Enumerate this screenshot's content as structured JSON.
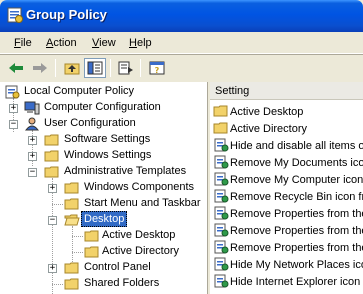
{
  "window": {
    "title": "Group Policy"
  },
  "menubar": [
    {
      "label": "File",
      "accel": "F",
      "rest": "ile"
    },
    {
      "label": "Action",
      "accel": "A",
      "rest": "ction"
    },
    {
      "label": "View",
      "accel": "V",
      "rest": "iew"
    },
    {
      "label": "Help",
      "accel": "H",
      "rest": "elp"
    }
  ],
  "toolbar": [
    "back-icon",
    "forward-icon",
    "up-folder-icon",
    "show-hide-tree-icon",
    "export-list-icon",
    "help-icon"
  ],
  "tree": [
    {
      "label": "Local Computer Policy",
      "icon": "policy-icon"
    },
    {
      "label": "Computer Configuration",
      "icon": "computer-icon",
      "expander": "+"
    },
    {
      "label": "User Configuration",
      "icon": "user-icon",
      "expander": "−"
    },
    {
      "label": "Software Settings",
      "icon": "folder-icon",
      "expander": "+"
    },
    {
      "label": "Windows Settings",
      "icon": "folder-icon",
      "expander": "+"
    },
    {
      "label": "Administrative Templates",
      "icon": "folder-icon",
      "expander": "−"
    },
    {
      "label": "Windows Components",
      "icon": "folder-icon",
      "expander": "+"
    },
    {
      "label": "Start Menu and Taskbar",
      "icon": "folder-icon"
    },
    {
      "label": "Desktop",
      "icon": "folder-open-icon",
      "expander": "−",
      "selected": true
    },
    {
      "label": "Active Desktop",
      "icon": "folder-icon"
    },
    {
      "label": "Active Directory",
      "icon": "folder-icon"
    },
    {
      "label": "Control Panel",
      "icon": "folder-icon",
      "expander": "+"
    },
    {
      "label": "Shared Folders",
      "icon": "folder-icon"
    }
  ],
  "list": {
    "column_header": "Setting",
    "items": [
      {
        "label": "Active Desktop",
        "icon": "folder-icon"
      },
      {
        "label": "Active Directory",
        "icon": "folder-icon"
      },
      {
        "label": "Hide and disable all items on",
        "icon": "policy-setting-icon"
      },
      {
        "label": "Remove My Documents icon",
        "icon": "policy-setting-icon"
      },
      {
        "label": "Remove My Computer icon o",
        "icon": "policy-setting-icon"
      },
      {
        "label": "Remove Recycle Bin icon fro",
        "icon": "policy-setting-icon"
      },
      {
        "label": "Remove Properties from the",
        "icon": "policy-setting-icon"
      },
      {
        "label": "Remove Properties from the",
        "icon": "policy-setting-icon"
      },
      {
        "label": "Remove Properties from the",
        "icon": "policy-setting-icon"
      },
      {
        "label": "Hide My Network Places ico",
        "icon": "policy-setting-icon"
      },
      {
        "label": "Hide Internet Explorer icon",
        "icon": "policy-setting-icon"
      }
    ]
  }
}
